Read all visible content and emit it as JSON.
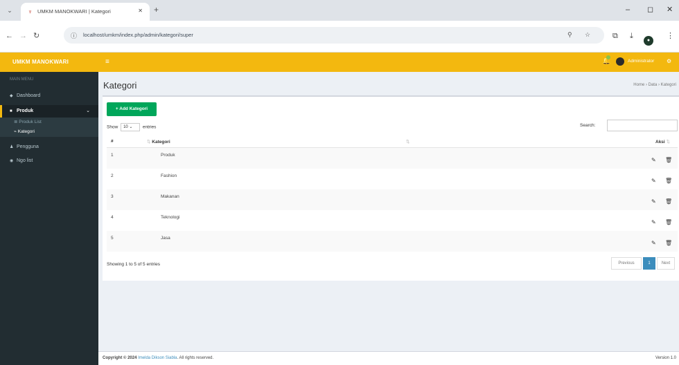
{
  "browser": {
    "tab_title": "UMKM MANOKWARI | Kategori",
    "url": "localhost/umkm/index.php/admin/kategori/super",
    "icons": [
      "tab-list-icon",
      "close-icon",
      "new-tab-icon",
      "back-icon",
      "forward-icon",
      "reload-icon",
      "info-icon",
      "zoom-icon",
      "star-icon",
      "extensions-icon",
      "download-icon",
      "profile-icon",
      "menu-icon",
      "minimize-icon",
      "maximize-icon"
    ]
  },
  "header": {
    "brand": "UMKM MANOKWARI",
    "user_name": "Administrator",
    "colors": {
      "bar": "#f3b80f",
      "notification": "#8bc34a"
    }
  },
  "sidebar": {
    "heading": "MAIN MENU",
    "items": [
      {
        "label": "Dashboard",
        "icon": "dashboard-icon"
      },
      {
        "label": "Produk",
        "icon": "box-icon"
      },
      {
        "label": "Pengguna",
        "icon": "users-icon"
      },
      {
        "label": "Ngo list",
        "icon": "list-icon"
      }
    ],
    "subitems": [
      {
        "label": "Produk List",
        "icon": "list-icon"
      },
      {
        "label": "Kategori",
        "icon": "tag-icon"
      }
    ]
  },
  "page": {
    "title": "Kategori",
    "breadcrumb": "Home › Data › Kategori",
    "add_button": "+ Add Kategori",
    "show_prefix": "Show",
    "show_value": "10",
    "show_suffix": "entries",
    "search_label": "Search:",
    "columns": {
      "no": "#",
      "kategori": "Kategori",
      "aksi": "Aksi"
    },
    "rows": [
      {
        "no": "1",
        "name": "Produk"
      },
      {
        "no": "2",
        "name": "Fashion"
      },
      {
        "no": "3",
        "name": "Makanan"
      },
      {
        "no": "4",
        "name": "Teknologi"
      },
      {
        "no": "5",
        "name": "Jasa"
      }
    ],
    "info": "Showing 1 to 5 of 5 entries",
    "pagination": {
      "previous": "Previous",
      "current": "1",
      "next": "Next"
    }
  },
  "footer": {
    "copyright_prefix": "Copyright © 2024",
    "copyright_link": "Imelda Dikson Siabla",
    "copyright_suffix": ". All rights reserved.",
    "version": "Version 1.0"
  }
}
